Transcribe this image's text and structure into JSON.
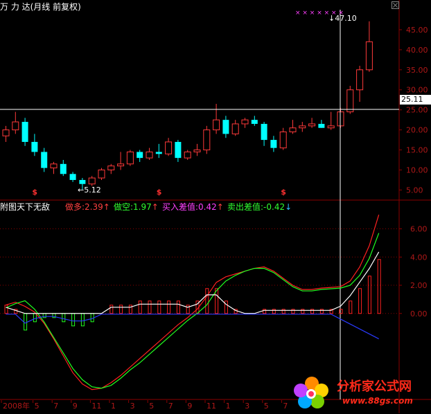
{
  "header": {
    "title": "万 力 达(月线 前复权)",
    "indicator_name": "附图天下无敌"
  },
  "indicators": [
    {
      "label": "做多:",
      "value": "2.39",
      "arrow": "↑",
      "color": "#ff4040"
    },
    {
      "label": "做空:",
      "value": "1.97",
      "arrow": "↑",
      "color": "#30ff30"
    },
    {
      "label": "买入差值:",
      "value": "0.42",
      "arrow": "↑",
      "color": "#ff40ff"
    },
    {
      "label": "卖出差值:",
      "value": "-0.42",
      "arrow": "↓",
      "color": "#30ff30",
      "arrow_color": "#30c0ff"
    }
  ],
  "markers": {
    "current_price": "25.11",
    "high_label": "47.10",
    "low_label": "5.12",
    "signal_symbol": "$",
    "high_marks": "× × × × × × ×"
  },
  "price_axis": {
    "ticks": [
      "45.00",
      "40.00",
      "35.00",
      "30.00",
      "25.00",
      "20.00",
      "15.00",
      "10.00",
      "5.00"
    ]
  },
  "indicator_axis": {
    "ticks": [
      "6.00",
      "4.00",
      "2.00",
      "0.00"
    ]
  },
  "time_axis": {
    "labels": [
      "2008年",
      "5",
      "7",
      "9",
      "11",
      "1",
      "3",
      "5",
      "7",
      "9",
      "11",
      "1",
      "3",
      "5",
      "7"
    ]
  },
  "colors": {
    "up": "#ff3a3a",
    "down": "#00ffff",
    "grid": "#8b0000",
    "long_line": "#ff2020",
    "short_line": "#20ff20",
    "white_line": "#ffffff",
    "blue_line": "#2a3aff"
  },
  "watermark": {
    "text": "分析家公式网",
    "url": "www.88gs.com"
  },
  "chart_data": {
    "type": "candlestick",
    "series": [
      {
        "name": "price",
        "ohlc": [
          [
            18.5,
            21.0,
            17.0,
            20.0
          ],
          [
            20.0,
            24.5,
            19.0,
            22.0
          ],
          [
            22.0,
            23.0,
            16.0,
            17.0
          ],
          [
            17.0,
            19.0,
            13.5,
            14.5
          ],
          [
            14.5,
            15.5,
            9.5,
            10.5
          ],
          [
            10.5,
            12.0,
            9.0,
            11.5
          ],
          [
            11.5,
            12.5,
            8.5,
            9.0
          ],
          [
            9.0,
            9.5,
            7.0,
            7.5
          ],
          [
            7.5,
            8.0,
            5.12,
            6.5
          ],
          [
            6.5,
            8.5,
            6.0,
            8.0
          ],
          [
            8.0,
            10.5,
            7.5,
            10.0
          ],
          [
            10.0,
            11.5,
            9.0,
            11.0
          ],
          [
            11.0,
            14.5,
            10.0,
            11.5
          ],
          [
            11.5,
            15.0,
            11.0,
            14.5
          ],
          [
            14.5,
            15.0,
            12.0,
            13.0
          ],
          [
            13.0,
            15.5,
            12.5,
            14.5
          ],
          [
            14.5,
            16.5,
            13.0,
            14.0
          ],
          [
            14.0,
            18.0,
            13.5,
            17.0
          ],
          [
            17.0,
            17.5,
            12.0,
            13.0
          ],
          [
            13.0,
            15.0,
            12.5,
            14.5
          ],
          [
            14.5,
            16.5,
            13.5,
            15.0
          ],
          [
            15.0,
            21.0,
            14.0,
            20.0
          ],
          [
            20.0,
            26.5,
            19.0,
            22.5
          ],
          [
            22.5,
            23.5,
            18.0,
            19.0
          ],
          [
            19.0,
            22.5,
            18.5,
            21.5
          ],
          [
            21.5,
            23.0,
            20.5,
            22.5
          ],
          [
            22.5,
            23.5,
            21.0,
            21.5
          ],
          [
            21.5,
            22.0,
            16.0,
            17.5
          ],
          [
            17.5,
            18.5,
            14.5,
            15.5
          ],
          [
            15.5,
            20.5,
            15.0,
            19.5
          ],
          [
            19.5,
            22.5,
            19.0,
            20.5
          ],
          [
            20.5,
            22.0,
            19.5,
            21.0
          ],
          [
            21.0,
            23.0,
            20.5,
            21.5
          ],
          [
            21.5,
            22.5,
            20.5,
            20.5
          ],
          [
            20.5,
            24.5,
            20.0,
            21.0
          ],
          [
            21.0,
            25.5,
            20.5,
            24.5
          ],
          [
            24.5,
            31.0,
            24.0,
            30.0
          ],
          [
            30.0,
            36.0,
            27.0,
            35.0
          ],
          [
            35.0,
            47.1,
            34.5,
            42.0
          ]
        ]
      },
      {
        "name": "做多",
        "values": [
          0.6,
          0.8,
          0.5,
          0.1,
          -0.7,
          -1.8,
          -3.0,
          -4.2,
          -5.0,
          -5.4,
          -5.3,
          -4.9,
          -4.4,
          -3.8,
          -3.2,
          -2.6,
          -2.0,
          -1.4,
          -0.8,
          -0.3,
          0.3,
          1.2,
          2.2,
          2.6,
          2.8,
          3.0,
          3.2,
          3.3,
          3.0,
          2.5,
          2.0,
          1.7,
          1.7,
          1.8,
          1.85,
          1.9,
          2.3,
          3.3,
          4.8,
          7.0
        ]
      },
      {
        "name": "做空",
        "values": [
          0.4,
          0.7,
          0.9,
          0.3,
          -0.6,
          -1.7,
          -2.8,
          -3.9,
          -4.7,
          -5.2,
          -5.3,
          -5.1,
          -4.6,
          -4.0,
          -3.5,
          -2.9,
          -2.3,
          -1.7,
          -1.1,
          -0.5,
          0.0,
          0.6,
          1.6,
          2.3,
          2.7,
          3.0,
          3.2,
          3.2,
          2.9,
          2.4,
          1.9,
          1.6,
          1.6,
          1.7,
          1.75,
          1.8,
          2.0,
          2.7,
          3.9,
          5.7
        ]
      }
    ],
    "ylim_price": [
      3.0,
      50.0
    ],
    "ylim_indicator": [
      -6.0,
      7.5
    ]
  }
}
